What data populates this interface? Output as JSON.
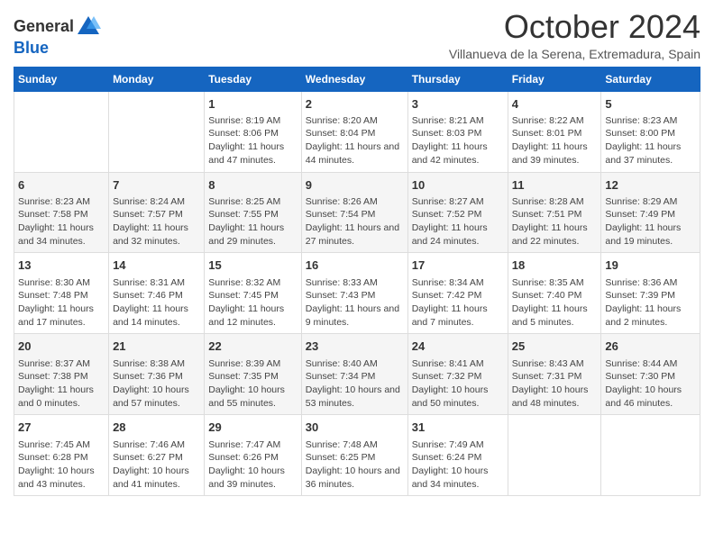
{
  "header": {
    "logo_general": "General",
    "logo_blue": "Blue",
    "month_title": "October 2024",
    "subtitle": "Villanueva de la Serena, Extremadura, Spain"
  },
  "days_of_week": [
    "Sunday",
    "Monday",
    "Tuesday",
    "Wednesday",
    "Thursday",
    "Friday",
    "Saturday"
  ],
  "weeks": [
    [
      {
        "day": "",
        "detail": ""
      },
      {
        "day": "",
        "detail": ""
      },
      {
        "day": "1",
        "detail": "Sunrise: 8:19 AM\nSunset: 8:06 PM\nDaylight: 11 hours and 47 minutes."
      },
      {
        "day": "2",
        "detail": "Sunrise: 8:20 AM\nSunset: 8:04 PM\nDaylight: 11 hours and 44 minutes."
      },
      {
        "day": "3",
        "detail": "Sunrise: 8:21 AM\nSunset: 8:03 PM\nDaylight: 11 hours and 42 minutes."
      },
      {
        "day": "4",
        "detail": "Sunrise: 8:22 AM\nSunset: 8:01 PM\nDaylight: 11 hours and 39 minutes."
      },
      {
        "day": "5",
        "detail": "Sunrise: 8:23 AM\nSunset: 8:00 PM\nDaylight: 11 hours and 37 minutes."
      }
    ],
    [
      {
        "day": "6",
        "detail": "Sunrise: 8:23 AM\nSunset: 7:58 PM\nDaylight: 11 hours and 34 minutes."
      },
      {
        "day": "7",
        "detail": "Sunrise: 8:24 AM\nSunset: 7:57 PM\nDaylight: 11 hours and 32 minutes."
      },
      {
        "day": "8",
        "detail": "Sunrise: 8:25 AM\nSunset: 7:55 PM\nDaylight: 11 hours and 29 minutes."
      },
      {
        "day": "9",
        "detail": "Sunrise: 8:26 AM\nSunset: 7:54 PM\nDaylight: 11 hours and 27 minutes."
      },
      {
        "day": "10",
        "detail": "Sunrise: 8:27 AM\nSunset: 7:52 PM\nDaylight: 11 hours and 24 minutes."
      },
      {
        "day": "11",
        "detail": "Sunrise: 8:28 AM\nSunset: 7:51 PM\nDaylight: 11 hours and 22 minutes."
      },
      {
        "day": "12",
        "detail": "Sunrise: 8:29 AM\nSunset: 7:49 PM\nDaylight: 11 hours and 19 minutes."
      }
    ],
    [
      {
        "day": "13",
        "detail": "Sunrise: 8:30 AM\nSunset: 7:48 PM\nDaylight: 11 hours and 17 minutes."
      },
      {
        "day": "14",
        "detail": "Sunrise: 8:31 AM\nSunset: 7:46 PM\nDaylight: 11 hours and 14 minutes."
      },
      {
        "day": "15",
        "detail": "Sunrise: 8:32 AM\nSunset: 7:45 PM\nDaylight: 11 hours and 12 minutes."
      },
      {
        "day": "16",
        "detail": "Sunrise: 8:33 AM\nSunset: 7:43 PM\nDaylight: 11 hours and 9 minutes."
      },
      {
        "day": "17",
        "detail": "Sunrise: 8:34 AM\nSunset: 7:42 PM\nDaylight: 11 hours and 7 minutes."
      },
      {
        "day": "18",
        "detail": "Sunrise: 8:35 AM\nSunset: 7:40 PM\nDaylight: 11 hours and 5 minutes."
      },
      {
        "day": "19",
        "detail": "Sunrise: 8:36 AM\nSunset: 7:39 PM\nDaylight: 11 hours and 2 minutes."
      }
    ],
    [
      {
        "day": "20",
        "detail": "Sunrise: 8:37 AM\nSunset: 7:38 PM\nDaylight: 11 hours and 0 minutes."
      },
      {
        "day": "21",
        "detail": "Sunrise: 8:38 AM\nSunset: 7:36 PM\nDaylight: 10 hours and 57 minutes."
      },
      {
        "day": "22",
        "detail": "Sunrise: 8:39 AM\nSunset: 7:35 PM\nDaylight: 10 hours and 55 minutes."
      },
      {
        "day": "23",
        "detail": "Sunrise: 8:40 AM\nSunset: 7:34 PM\nDaylight: 10 hours and 53 minutes."
      },
      {
        "day": "24",
        "detail": "Sunrise: 8:41 AM\nSunset: 7:32 PM\nDaylight: 10 hours and 50 minutes."
      },
      {
        "day": "25",
        "detail": "Sunrise: 8:43 AM\nSunset: 7:31 PM\nDaylight: 10 hours and 48 minutes."
      },
      {
        "day": "26",
        "detail": "Sunrise: 8:44 AM\nSunset: 7:30 PM\nDaylight: 10 hours and 46 minutes."
      }
    ],
    [
      {
        "day": "27",
        "detail": "Sunrise: 7:45 AM\nSunset: 6:28 PM\nDaylight: 10 hours and 43 minutes."
      },
      {
        "day": "28",
        "detail": "Sunrise: 7:46 AM\nSunset: 6:27 PM\nDaylight: 10 hours and 41 minutes."
      },
      {
        "day": "29",
        "detail": "Sunrise: 7:47 AM\nSunset: 6:26 PM\nDaylight: 10 hours and 39 minutes."
      },
      {
        "day": "30",
        "detail": "Sunrise: 7:48 AM\nSunset: 6:25 PM\nDaylight: 10 hours and 36 minutes."
      },
      {
        "day": "31",
        "detail": "Sunrise: 7:49 AM\nSunset: 6:24 PM\nDaylight: 10 hours and 34 minutes."
      },
      {
        "day": "",
        "detail": ""
      },
      {
        "day": "",
        "detail": ""
      }
    ]
  ]
}
